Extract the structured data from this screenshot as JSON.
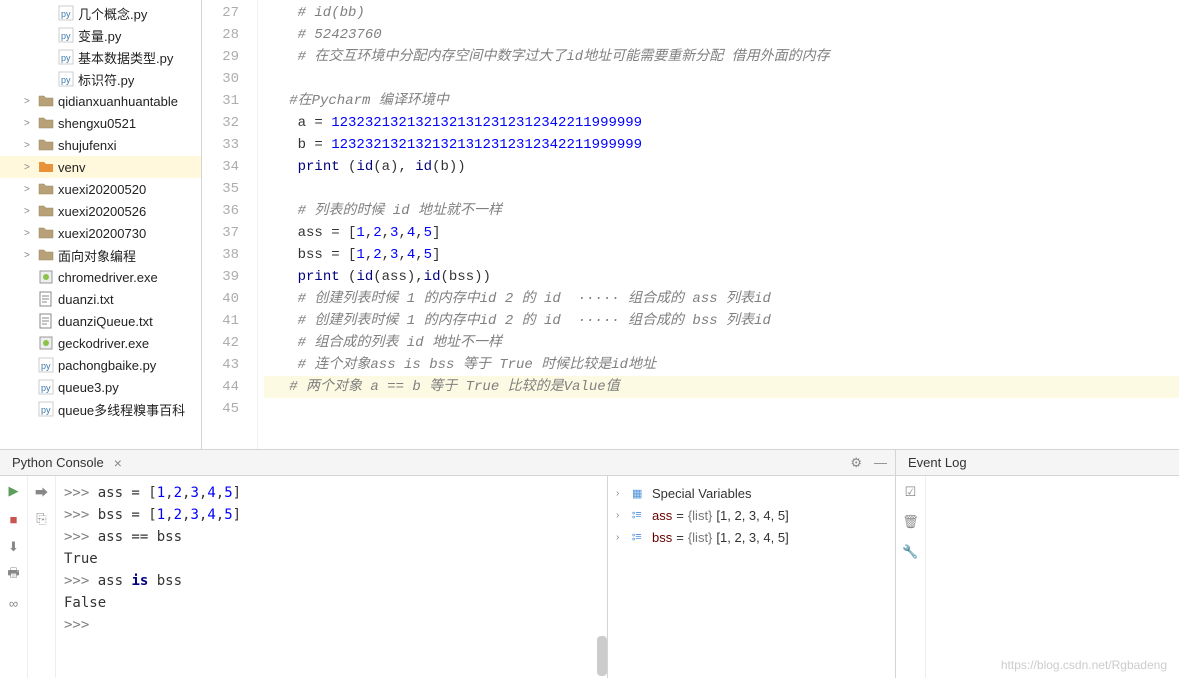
{
  "tree": {
    "items": [
      {
        "indent": 2,
        "icon": "py",
        "label": "几个概念.py",
        "interact": true
      },
      {
        "indent": 2,
        "icon": "py",
        "label": "变量.py",
        "interact": true
      },
      {
        "indent": 2,
        "icon": "py",
        "label": "基本数据类型.py",
        "interact": true
      },
      {
        "indent": 2,
        "icon": "py",
        "label": "标识符.py",
        "interact": true
      },
      {
        "indent": 1,
        "icon": "folder",
        "chev": ">",
        "label": "qidianxuanhuantable",
        "interact": true
      },
      {
        "indent": 1,
        "icon": "folder",
        "chev": ">",
        "label": "shengxu0521",
        "interact": true
      },
      {
        "indent": 1,
        "icon": "folder",
        "chev": ">",
        "label": "shujufenxi",
        "interact": true
      },
      {
        "indent": 1,
        "icon": "folder-orange",
        "chev": ">",
        "label": "venv",
        "interact": true,
        "selected": true
      },
      {
        "indent": 1,
        "icon": "folder",
        "chev": ">",
        "label": "xuexi20200520",
        "interact": true
      },
      {
        "indent": 1,
        "icon": "folder",
        "chev": ">",
        "label": "xuexi20200526",
        "interact": true
      },
      {
        "indent": 1,
        "icon": "folder",
        "chev": ">",
        "label": "xuexi20200730",
        "interact": true
      },
      {
        "indent": 1,
        "icon": "folder",
        "chev": ">",
        "label": "面向对象编程",
        "interact": true
      },
      {
        "indent": 1,
        "icon": "exe",
        "label": "chromedriver.exe",
        "interact": true
      },
      {
        "indent": 1,
        "icon": "txt",
        "label": "duanzi.txt",
        "interact": true
      },
      {
        "indent": 1,
        "icon": "txt",
        "label": "duanziQueue.txt",
        "interact": true
      },
      {
        "indent": 1,
        "icon": "exe",
        "label": "geckodriver.exe",
        "interact": true
      },
      {
        "indent": 1,
        "icon": "py",
        "label": "pachongbaike.py",
        "interact": true
      },
      {
        "indent": 1,
        "icon": "py",
        "label": "queue3.py",
        "interact": true
      },
      {
        "indent": 1,
        "icon": "py",
        "label": "queue多线程糗事百科",
        "interact": true
      }
    ]
  },
  "editor": {
    "lines": [
      {
        "n": 27,
        "seg": [
          {
            "t": "    # id(bb)",
            "c": "c-comment"
          }
        ]
      },
      {
        "n": 28,
        "seg": [
          {
            "t": "    # 52423760",
            "c": "c-comment"
          }
        ]
      },
      {
        "n": 29,
        "seg": [
          {
            "t": "    # 在交互环境中分配内存空间中数字过大了id地址可能需要重新分配 借用外面的内存",
            "c": "c-comment"
          }
        ]
      },
      {
        "n": 30,
        "seg": [
          {
            "t": " ",
            "c": ""
          }
        ]
      },
      {
        "n": 31,
        "seg": [
          {
            "t": "   #在Pycharm 编译环境中",
            "c": "c-comment"
          }
        ]
      },
      {
        "n": 32,
        "seg": [
          {
            "t": "    a = ",
            "c": ""
          },
          {
            "t": "1232321321321321312312312342211999999",
            "c": "c-number"
          }
        ]
      },
      {
        "n": 33,
        "seg": [
          {
            "t": "    b = ",
            "c": ""
          },
          {
            "t": "1232321321321321312312312342211999999",
            "c": "c-number"
          }
        ]
      },
      {
        "n": 34,
        "seg": [
          {
            "t": "    ",
            "c": ""
          },
          {
            "t": "print",
            "c": "c-builtin"
          },
          {
            "t": " (",
            "c": ""
          },
          {
            "t": "id",
            "c": "c-builtin"
          },
          {
            "t": "(a), ",
            "c": ""
          },
          {
            "t": "id",
            "c": "c-builtin"
          },
          {
            "t": "(b))",
            "c": ""
          }
        ]
      },
      {
        "n": 35,
        "seg": [
          {
            "t": " ",
            "c": ""
          }
        ]
      },
      {
        "n": 36,
        "seg": [
          {
            "t": "    # 列表的时候 id 地址就不一样",
            "c": "c-comment"
          }
        ]
      },
      {
        "n": 37,
        "seg": [
          {
            "t": "    ass = [",
            "c": ""
          },
          {
            "t": "1",
            "c": "c-number"
          },
          {
            "t": ",",
            "c": ""
          },
          {
            "t": "2",
            "c": "c-number"
          },
          {
            "t": ",",
            "c": ""
          },
          {
            "t": "3",
            "c": "c-number"
          },
          {
            "t": ",",
            "c": ""
          },
          {
            "t": "4",
            "c": "c-number"
          },
          {
            "t": ",",
            "c": ""
          },
          {
            "t": "5",
            "c": "c-number"
          },
          {
            "t": "]",
            "c": ""
          }
        ]
      },
      {
        "n": 38,
        "seg": [
          {
            "t": "    bss = [",
            "c": ""
          },
          {
            "t": "1",
            "c": "c-number"
          },
          {
            "t": ",",
            "c": ""
          },
          {
            "t": "2",
            "c": "c-number"
          },
          {
            "t": ",",
            "c": ""
          },
          {
            "t": "3",
            "c": "c-number"
          },
          {
            "t": ",",
            "c": ""
          },
          {
            "t": "4",
            "c": "c-number"
          },
          {
            "t": ",",
            "c": ""
          },
          {
            "t": "5",
            "c": "c-number"
          },
          {
            "t": "]",
            "c": ""
          }
        ]
      },
      {
        "n": 39,
        "seg": [
          {
            "t": "    ",
            "c": ""
          },
          {
            "t": "print",
            "c": "c-builtin"
          },
          {
            "t": " (",
            "c": ""
          },
          {
            "t": "id",
            "c": "c-builtin"
          },
          {
            "t": "(ass),",
            "c": ""
          },
          {
            "t": "id",
            "c": "c-builtin"
          },
          {
            "t": "(bss))",
            "c": ""
          }
        ]
      },
      {
        "n": 40,
        "seg": [
          {
            "t": "    # 创建列表时候 1 的内存中id 2 的 id  ····· 组合成的 ass 列表id",
            "c": "c-comment"
          }
        ]
      },
      {
        "n": 41,
        "seg": [
          {
            "t": "    # 创建列表时候 1 的内存中id 2 的 id  ····· 组合成的 bss 列表id",
            "c": "c-comment"
          }
        ]
      },
      {
        "n": 42,
        "seg": [
          {
            "t": "    # 组合成的列表 id 地址不一样",
            "c": "c-comment"
          }
        ]
      },
      {
        "n": 43,
        "seg": [
          {
            "t": "    # 连个对象ass is bss 等于 True 时候比较是id地址",
            "c": "c-comment"
          }
        ]
      },
      {
        "n": 44,
        "seg": [
          {
            "t": "   # 两个对象 a == b 等于 True 比较的是Value值",
            "c": "c-comment"
          }
        ],
        "current": true
      },
      {
        "n": 45,
        "seg": [
          {
            "t": " ",
            "c": ""
          }
        ]
      }
    ]
  },
  "console": {
    "title": "Python Console",
    "lines": [
      {
        "seg": [
          {
            "t": ">>> ",
            "c": "prompt"
          },
          {
            "t": "ass = [",
            "c": ""
          },
          {
            "t": "1",
            "c": "pynum"
          },
          {
            "t": ",",
            "c": ""
          },
          {
            "t": "2",
            "c": "pynum"
          },
          {
            "t": ",",
            "c": ""
          },
          {
            "t": "3",
            "c": "pynum"
          },
          {
            "t": ",",
            "c": ""
          },
          {
            "t": "4",
            "c": "pynum"
          },
          {
            "t": ",",
            "c": ""
          },
          {
            "t": "5",
            "c": "pynum"
          },
          {
            "t": "]",
            "c": ""
          }
        ]
      },
      {
        "seg": [
          {
            "t": ">>> ",
            "c": "prompt"
          },
          {
            "t": "bss = [",
            "c": ""
          },
          {
            "t": "1",
            "c": "pynum"
          },
          {
            "t": ",",
            "c": ""
          },
          {
            "t": "2",
            "c": "pynum"
          },
          {
            "t": ",",
            "c": ""
          },
          {
            "t": "3",
            "c": "pynum"
          },
          {
            "t": ",",
            "c": ""
          },
          {
            "t": "4",
            "c": "pynum"
          },
          {
            "t": ",",
            "c": ""
          },
          {
            "t": "5",
            "c": "pynum"
          },
          {
            "t": "]",
            "c": ""
          }
        ]
      },
      {
        "seg": [
          {
            "t": ">>> ",
            "c": "prompt"
          },
          {
            "t": "ass == bss",
            "c": ""
          }
        ]
      },
      {
        "seg": [
          {
            "t": "True",
            "c": ""
          }
        ]
      },
      {
        "seg": [
          {
            "t": ">>> ",
            "c": "prompt"
          },
          {
            "t": "ass ",
            "c": ""
          },
          {
            "t": "is",
            "c": "pykey"
          },
          {
            "t": " bss",
            "c": ""
          }
        ]
      },
      {
        "seg": [
          {
            "t": "False",
            "c": ""
          }
        ]
      },
      {
        "seg": [
          {
            "t": " ",
            "c": ""
          }
        ]
      },
      {
        "seg": [
          {
            "t": ">>> ",
            "c": "prompt"
          }
        ]
      }
    ]
  },
  "vars": {
    "special": "Special Variables",
    "items": [
      {
        "name": "ass",
        "type": "{list}",
        "val": "[1, 2, 3, 4, 5]"
      },
      {
        "name": "bss",
        "type": "{list}",
        "val": "[1, 2, 3, 4, 5]"
      }
    ]
  },
  "eventlog": {
    "title": "Event Log"
  },
  "watermark": "https://blog.csdn.net/Rgbadeng"
}
